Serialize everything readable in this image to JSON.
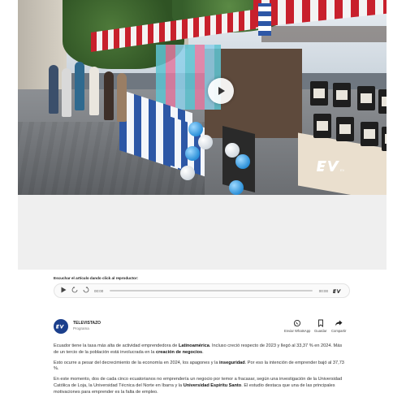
{
  "video": {
    "watermark": "EV"
  },
  "player": {
    "listen_label": "Escuchar el artículo dando click al reproductor:",
    "current_time": "00:00",
    "total_time": "00:00",
    "logo_text": "EV"
  },
  "byline": {
    "avatar_text": "EV",
    "author": "TELEVISTAZO",
    "role": "Programa"
  },
  "share": [
    {
      "icon": "whatsapp-icon",
      "label": "Enviar WhatsApp"
    },
    {
      "icon": "bookmark-icon",
      "label": "Guardar"
    },
    {
      "icon": "share-icon",
      "label": "Compartir"
    }
  ],
  "article": {
    "p1": {
      "a": "Ecuador tiene la tasa más alta de actividad emprendedora de ",
      "b": "Latinoamérica",
      "c": ". Incluso creció respecto de 2023 y llegó al 33,37 % en 2024. Más de un tercio de la población está involucrada en la ",
      "d": "creación de negocios",
      "e": "."
    },
    "p2": {
      "a": "Esto ocurre a pesar del decrecimiento de la economía en 2024, los apagones y la ",
      "b": "inseguridad",
      "c": ". Por eso la intención de emprender bajó al 37,73 %."
    },
    "p3": {
      "a": "En este momento, dos de cada cinco ecuatorianos no emprendería un negocio por temor a fracasar, según una investigación de la Universidad Católica de Loja, la Universidad Técnica del Norte en Ibarra y la ",
      "b": "Universidad Espíritu Santo",
      "c": ". El estudio destaca que una de las principales motivaciones para emprender es la falta de empleo."
    }
  },
  "colors": {
    "brand_blue": "#1b3f8c",
    "ad_grey": "#efefef"
  }
}
